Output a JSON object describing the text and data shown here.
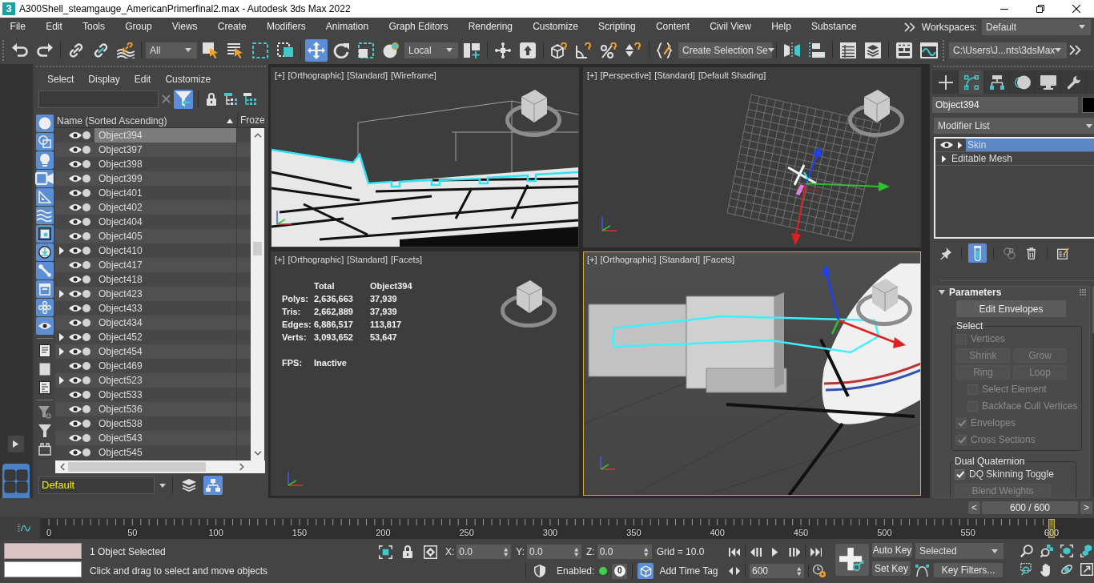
{
  "window": {
    "logo": "3",
    "title": "A300Shell_steamgauge_AmericanPrimerfinal2.max - Autodesk 3ds Max 2022"
  },
  "menu_bar": {
    "items": [
      "File",
      "Edit",
      "Tools",
      "Group",
      "Views",
      "Create",
      "Modifiers",
      "Animation",
      "Graph Editors",
      "Rendering",
      "Customize",
      "Scripting",
      "Content",
      "Civil View",
      "Help",
      "Substance"
    ],
    "workspaces_label": "Workspaces:",
    "workspace": "Default"
  },
  "main_toolbar": {
    "tools": [
      {
        "on": false
      },
      {
        "on": false
      },
      {
        "on": false
      },
      {
        "on": false
      },
      {
        "on": false
      },
      {
        "on": false
      },
      {
        "on": false
      },
      {
        "on": false
      },
      {
        "on": false
      },
      {
        "on": true
      },
      {
        "on": false
      },
      {
        "on": false
      },
      {
        "on": false
      },
      {
        "on": false
      },
      {
        "on": false
      },
      {
        "on": false
      },
      {
        "on": false
      },
      {
        "on": false
      },
      {
        "on": false
      },
      {
        "on": false
      },
      {
        "on": false
      },
      {
        "on": false
      },
      {
        "on": false
      },
      {
        "on": false
      },
      {
        "on": false
      },
      {
        "on": false
      },
      {
        "on": false
      }
    ],
    "selection_filter": "All",
    "reference_coordinate_system": "Local",
    "named_selection_set": "Create Selection Se",
    "project_folder": "C:\\Users\\J...nts\\3dsMax"
  },
  "scene_explorer": {
    "menu": [
      "Select",
      "Display",
      "Edit",
      "Customize"
    ],
    "tools": [
      {
        "on": true
      },
      {
        "on": false
      },
      {
        "on": false
      },
      {
        "on": false
      }
    ],
    "filters": [
      {
        "on": true
      },
      {
        "on": true
      },
      {
        "on": true
      },
      {
        "on": true
      },
      {
        "on": true
      },
      {
        "on": true
      },
      {
        "on": true
      },
      {
        "on": true
      },
      {
        "on": true
      },
      {
        "on": true
      },
      {
        "on": true
      },
      {
        "on": true
      },
      {
        "on": false
      },
      {
        "on": false
      },
      {
        "on": false
      },
      {
        "on": false
      },
      {
        "on": false
      },
      {
        "on": false
      }
    ],
    "columns": [
      "Name (Sorted Ascending)",
      "Froze"
    ],
    "rows": [
      {
        "name": "Object394",
        "selected": true,
        "expandable": false
      },
      {
        "name": "Object397",
        "selected": false,
        "expandable": false
      },
      {
        "name": "Object398",
        "selected": false,
        "expandable": false
      },
      {
        "name": "Object399",
        "selected": false,
        "expandable": false
      },
      {
        "name": "Object401",
        "selected": false,
        "expandable": false
      },
      {
        "name": "Object402",
        "selected": false,
        "expandable": false
      },
      {
        "name": "Object404",
        "selected": false,
        "expandable": false
      },
      {
        "name": "Object405",
        "selected": false,
        "expandable": false
      },
      {
        "name": "Object410",
        "selected": false,
        "expandable": true
      },
      {
        "name": "Object417",
        "selected": false,
        "expandable": false
      },
      {
        "name": "Object418",
        "selected": false,
        "expandable": false
      },
      {
        "name": "Object423",
        "selected": false,
        "expandable": true
      },
      {
        "name": "Object433",
        "selected": false,
        "expandable": false
      },
      {
        "name": "Object434",
        "selected": false,
        "expandable": false
      },
      {
        "name": "Object452",
        "selected": false,
        "expandable": true
      },
      {
        "name": "Object454",
        "selected": false,
        "expandable": true
      },
      {
        "name": "Object469",
        "selected": false,
        "expandable": false
      },
      {
        "name": "Object523",
        "selected": false,
        "expandable": true
      },
      {
        "name": "Object533",
        "selected": false,
        "expandable": false
      },
      {
        "name": "Object536",
        "selected": false,
        "expandable": false
      },
      {
        "name": "Object538",
        "selected": false,
        "expandable": false
      },
      {
        "name": "Object543",
        "selected": false,
        "expandable": false
      },
      {
        "name": "Object545",
        "selected": false,
        "expandable": false
      }
    ],
    "layer": "Default",
    "layer_tools": [
      {
        "on": false
      },
      {
        "on": true
      }
    ]
  },
  "viewports": [
    {
      "label": [
        "[+]",
        "[Orthographic]",
        "[Standard]",
        "[Wireframe]"
      ],
      "kind": "wireframe",
      "active": false
    },
    {
      "label": [
        "[+]",
        "[Perspective]",
        "[Standard]",
        "[Default Shading]"
      ],
      "kind": "perspective",
      "active": false
    },
    {
      "label": [
        "[+]",
        "[Orthographic]",
        "[Standard]",
        "[Facets]"
      ],
      "kind": "statistics",
      "active": false,
      "statistics": {
        "columns": [
          "Total",
          "Object394"
        ],
        "rows": [
          {
            "label": "Polys:",
            "values": [
              "2,636,663",
              "37,939"
            ]
          },
          {
            "label": "Tris:",
            "values": [
              "2,662,889",
              "37,939"
            ]
          },
          {
            "label": "Edges:",
            "values": [
              "6,886,517",
              "113,817"
            ]
          },
          {
            "label": "Verts:",
            "values": [
              "3,093,652",
              "53,647"
            ]
          }
        ],
        "fps_label": "FPS:",
        "fps": "Inactive"
      }
    },
    {
      "label": [
        "[+]",
        "[Orthographic]",
        "[Standard]",
        "[Facets]"
      ],
      "kind": "shaded",
      "active": true
    }
  ],
  "command_panel": {
    "tabs": [
      {
        "selected": false
      },
      {
        "selected": true
      },
      {
        "selected": false
      },
      {
        "selected": false
      },
      {
        "selected": false
      },
      {
        "selected": false
      }
    ],
    "object_name": "Object394",
    "modifier_list": "Modifier List",
    "modifier_stack": [
      {
        "kind": "modifier",
        "name": "Skin",
        "enabled": true,
        "expanded": false,
        "selected": true
      },
      {
        "kind": "base_object",
        "name": "Editable Mesh",
        "expanded": false,
        "selected": false
      }
    ],
    "stack_tools": [
      {
        "on": false
      },
      {
        "on": true
      },
      {
        "on": false
      },
      {
        "on": false
      },
      {
        "on": false
      }
    ],
    "rollout": {
      "title": "Parameters",
      "expanded": true,
      "button": "Edit Envelopes",
      "groups": [
        {
          "title": "Select",
          "controls": [
            {
              "kind": "checkbox",
              "label": "Vertices",
              "checked": false,
              "disabled": true
            },
            {
              "kind": "button_pair",
              "labels": [
                "Shrink",
                "Grow"
              ],
              "disabled": true
            },
            {
              "kind": "button_pair",
              "labels": [
                "Ring",
                "Loop"
              ],
              "disabled": true
            },
            {
              "kind": "sub_checkbox",
              "label": "Select Element",
              "checked": false,
              "disabled": true
            },
            {
              "kind": "sub_checkbox",
              "label": "Backface Cull Vertices",
              "checked": false,
              "disabled": true
            },
            {
              "kind": "checkbox",
              "label": "Envelopes",
              "checked": true,
              "disabled": true
            },
            {
              "kind": "checkbox",
              "label": "Cross Sections",
              "checked": true,
              "disabled": true
            }
          ]
        },
        {
          "title": "Dual Quaternion",
          "controls": [
            {
              "kind": "checkbox",
              "label": "DQ Skinning Toggle",
              "checked": true,
              "disabled": false
            },
            {
              "kind": "button",
              "label": "Blend Weights",
              "disabled": true
            }
          ]
        }
      ]
    }
  },
  "timeline": {
    "time_slider": {
      "previous": "<",
      "label": "600 / 600",
      "next": ">",
      "level": 1
    },
    "frame_labels": [
      "0",
      "50",
      "100",
      "150",
      "200",
      "250",
      "300",
      "350",
      "400",
      "450",
      "500",
      "550",
      "600"
    ]
  },
  "status_bar": {
    "selection_info": "1 Object Selected",
    "prompt": "Click and drag to select and move objects",
    "coordinates": [
      {
        "axis": "X:",
        "value": "0.0"
      },
      {
        "axis": "Y:",
        "value": "0.0"
      },
      {
        "axis": "Z:",
        "value": "0.0"
      }
    ],
    "grid": "Grid = 10.0",
    "adaptive_degradation": {
      "label": "Enabled:",
      "on": true
    },
    "counter": "0",
    "time_tag": "Add Time Tag",
    "current_frame": "600",
    "auto_key": {
      "label": "Auto Key",
      "on": false
    },
    "set_key": "Set Key",
    "key_set": "Selected",
    "key_filters": "Key Filters..."
  }
}
